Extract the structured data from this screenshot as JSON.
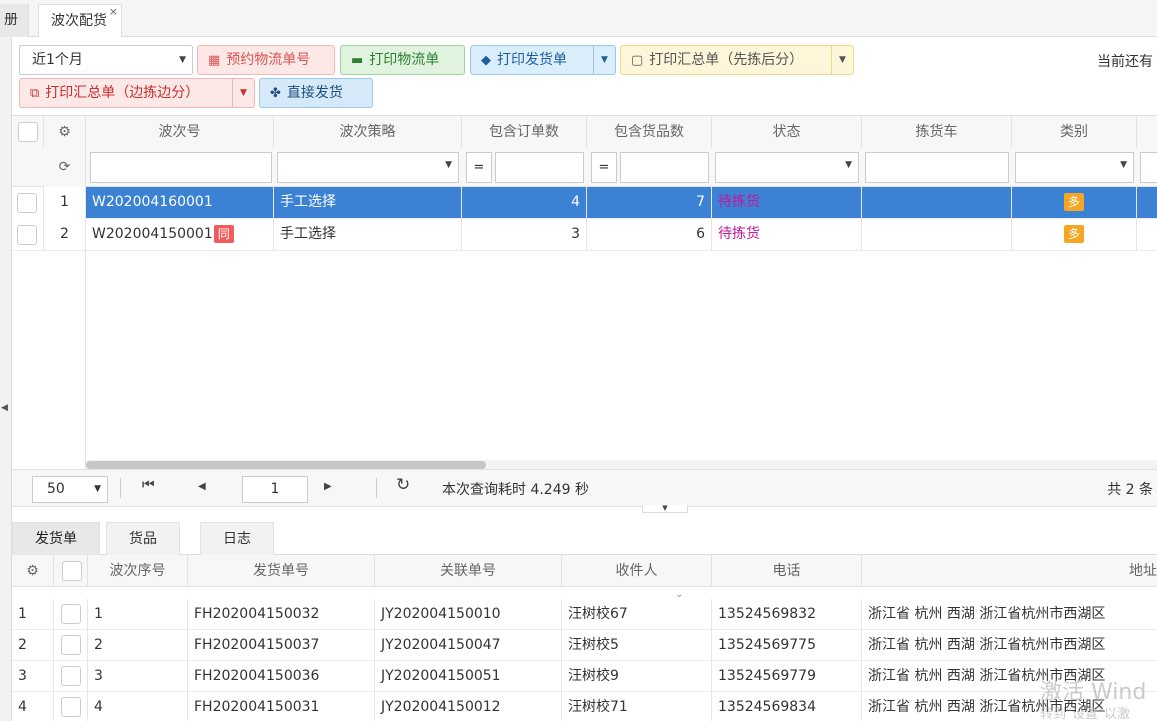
{
  "tabs": {
    "prev": "册",
    "active": "波次配货",
    "close": "×"
  },
  "toolbar": {
    "period": "近1个月",
    "btn_book_logistics": "预约物流单号",
    "btn_print_logistics": "打印物流单",
    "btn_print_delivery": "打印发货单",
    "btn_print_summary_pick_first": "打印汇总单（先拣后分）",
    "btn_print_summary_pick_sort": "打印汇总单（边拣边分）",
    "btn_direct_ship": "直接发货",
    "remain_text": "当前还有"
  },
  "grid": {
    "headers": [
      "波次号",
      "波次策略",
      "包含订单数",
      "包含货品数",
      "状态",
      "拣货车",
      "类别"
    ],
    "eq": "=",
    "rows": [
      {
        "num": "1",
        "wave_no": "W202004160001",
        "strategy": "手工选择",
        "orders": "4",
        "goods": "7",
        "status": "待拣货",
        "cart": "",
        "type": "多",
        "tag": ""
      },
      {
        "num": "2",
        "wave_no": "W202004150001",
        "strategy": "手工选择",
        "orders": "3",
        "goods": "6",
        "status": "待拣货",
        "cart": "",
        "type": "多",
        "tag": "同"
      }
    ]
  },
  "pager": {
    "page_size": "50",
    "page": "1",
    "info": "本次查询耗时 4.249 秒",
    "total": "共 2 条"
  },
  "subtabs": [
    "发货单",
    "货品",
    "日志"
  ],
  "grid2": {
    "headers": [
      "波次序号",
      "发货单号",
      "关联单号",
      "收件人",
      "电话",
      "地址"
    ],
    "rows": [
      {
        "idx": "1",
        "seq": "1",
        "delivery_no": "FH202004150032",
        "ref_no": "JY202004150010",
        "recipient": "汪树校67",
        "phone": "13524569832",
        "address": "浙江省 杭州 西湖 浙江省杭州市西湖区"
      },
      {
        "idx": "2",
        "seq": "2",
        "delivery_no": "FH202004150037",
        "ref_no": "JY202004150047",
        "recipient": "汪树校5",
        "phone": "13524569775",
        "address": "浙江省 杭州 西湖 浙江省杭州市西湖区"
      },
      {
        "idx": "3",
        "seq": "3",
        "delivery_no": "FH202004150036",
        "ref_no": "JY202004150051",
        "recipient": "汪树校9",
        "phone": "13524569779",
        "address": "浙江省 杭州 西湖 浙江省杭州市西湖区"
      },
      {
        "idx": "4",
        "seq": "4",
        "delivery_no": "FH202004150031",
        "ref_no": "JY202004150012",
        "recipient": "汪树校71",
        "phone": "13524569834",
        "address": "浙江省 杭州 西湖 浙江省杭州市西湖区"
      }
    ]
  },
  "watermark": {
    "line1": "激活 Wind",
    "line2": "转到\"设置\"以激"
  },
  "colors": {
    "selected_row": "#3b82d4",
    "status": "#c2189a",
    "tag_duo": "#f5a623",
    "tag_tong": "#f15b5b"
  }
}
